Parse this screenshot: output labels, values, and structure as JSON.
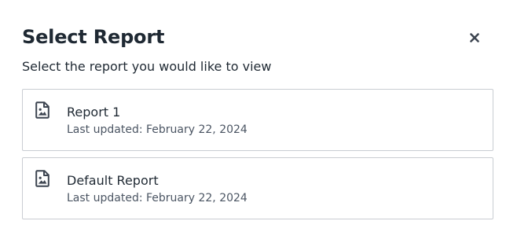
{
  "dialog": {
    "title": "Select Report",
    "subtitle": "Select the report you would like to view",
    "close_icon": "close-icon"
  },
  "reports": [
    {
      "name": "Report 1",
      "updated": "Last updated: February 22, 2024",
      "icon": "report-file-icon"
    },
    {
      "name": "Default Report",
      "updated": "Last updated: February 22, 2024",
      "icon": "report-file-icon"
    }
  ],
  "colors": {
    "text_primary": "#1f2933",
    "text_secondary": "#4b5563",
    "border": "#c9cdd2",
    "icon": "#3d4551"
  }
}
